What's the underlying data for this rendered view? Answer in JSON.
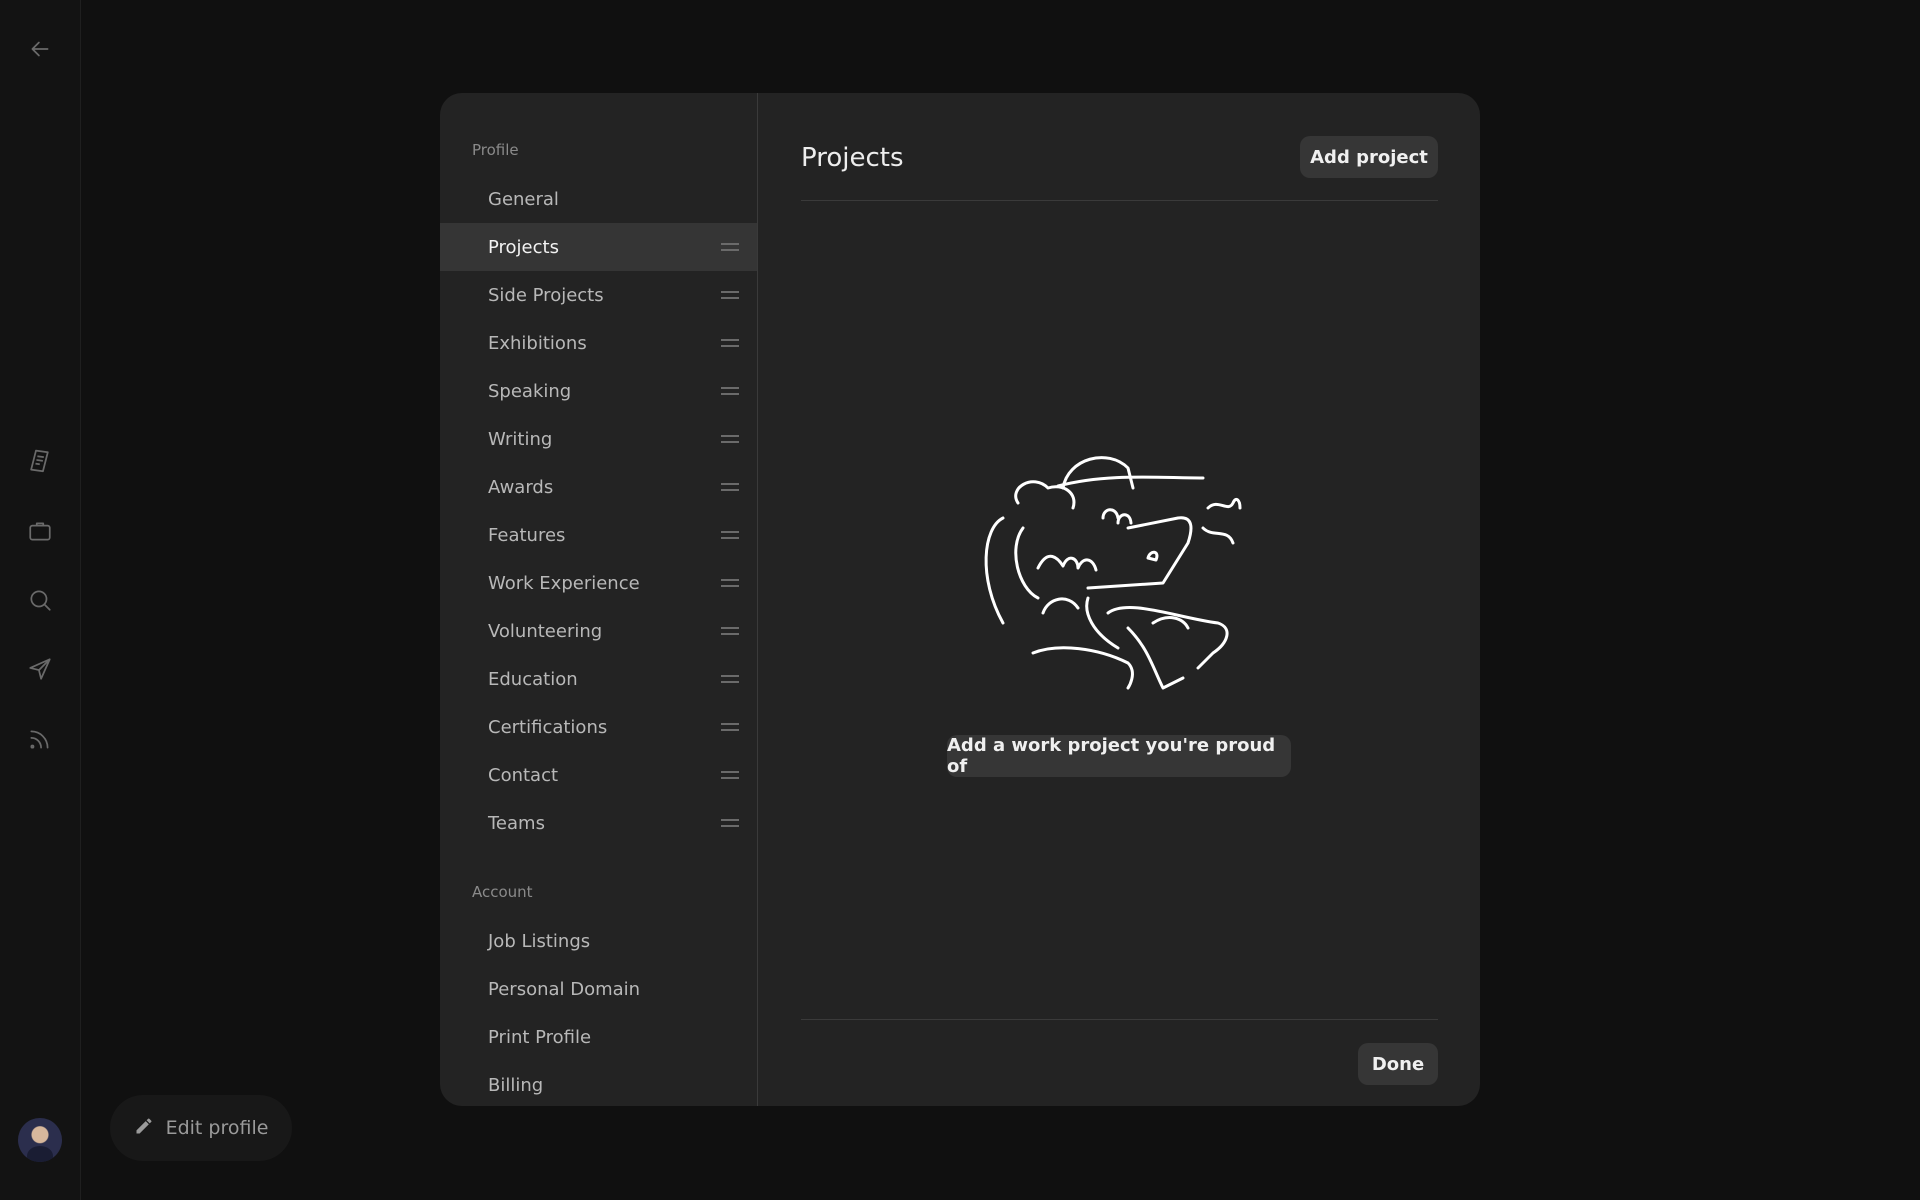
{
  "rail": {
    "icons": [
      "back-arrow-icon",
      "document-icon",
      "briefcase-icon",
      "search-icon",
      "send-icon",
      "rss-icon"
    ]
  },
  "edit_profile": {
    "label": "Edit profile",
    "icon": "pencil-icon"
  },
  "modal": {
    "sidebar": {
      "profile_label": "Profile",
      "profile_items": [
        {
          "label": "General",
          "draggable": false
        },
        {
          "label": "Projects",
          "draggable": true,
          "active": true
        },
        {
          "label": "Side Projects",
          "draggable": true
        },
        {
          "label": "Exhibitions",
          "draggable": true
        },
        {
          "label": "Speaking",
          "draggable": true
        },
        {
          "label": "Writing",
          "draggable": true
        },
        {
          "label": "Awards",
          "draggable": true
        },
        {
          "label": "Features",
          "draggable": true
        },
        {
          "label": "Work Experience",
          "draggable": true
        },
        {
          "label": "Volunteering",
          "draggable": true
        },
        {
          "label": "Education",
          "draggable": true
        },
        {
          "label": "Certifications",
          "draggable": true
        },
        {
          "label": "Contact",
          "draggable": true
        },
        {
          "label": "Teams",
          "draggable": true
        }
      ],
      "account_label": "Account",
      "account_items": [
        {
          "label": "Job Listings"
        },
        {
          "label": "Personal Domain"
        },
        {
          "label": "Print Profile"
        },
        {
          "label": "Billing"
        }
      ]
    },
    "content": {
      "title": "Projects",
      "add_button": "Add project",
      "empty_cta": "Add a work project you're proud of",
      "done_button": "Done"
    }
  }
}
